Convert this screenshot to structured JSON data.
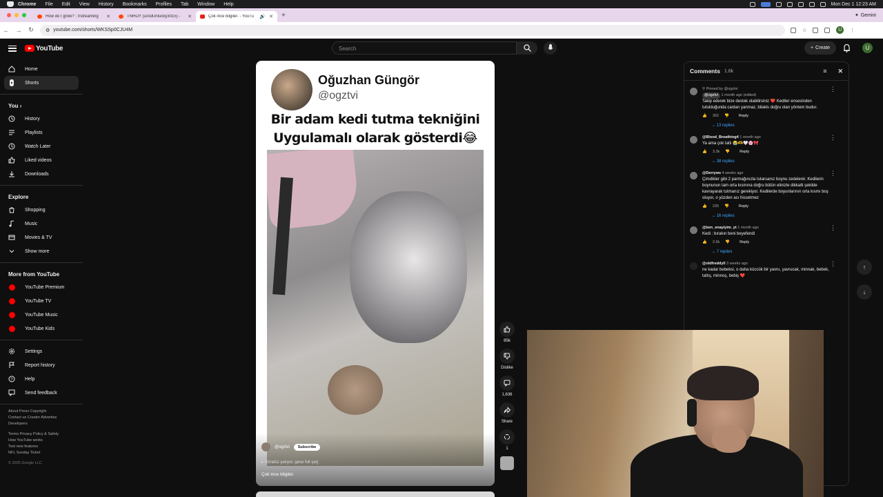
{
  "macos": {
    "app_name": "Chrome",
    "menus": [
      "File",
      "Edit",
      "View",
      "History",
      "Bookmarks",
      "Profiles",
      "Tab",
      "Window",
      "Help"
    ],
    "clock": "Mon Dec 1  12:23 AM"
  },
  "tabs": [
    {
      "title": "How do I grow? : r/streaming",
      "active": false
    },
    {
      "title": "TNROY (u/AdUnlucky3015) -",
      "active": false
    },
    {
      "title": "Çok ince bilgiler. - YouTu",
      "active": true
    }
  ],
  "browser": {
    "url": "youtube.com/shorts/WKSSp0CJU4M",
    "gemini_label": "Gemini",
    "profile_initial": "U"
  },
  "youtube": {
    "logo_text": "YouTube",
    "search_placeholder": "Search",
    "create_label": "Create",
    "avatar_initial": "U"
  },
  "sidebar": {
    "main": [
      {
        "label": "Home",
        "icon": "home-icon"
      },
      {
        "label": "Shorts",
        "icon": "shorts-icon",
        "active": true
      }
    ],
    "you_header": "You",
    "you_items": [
      {
        "label": "History",
        "icon": "history-icon"
      },
      {
        "label": "Playlists",
        "icon": "playlists-icon"
      },
      {
        "label": "Watch Later",
        "icon": "watch-later-icon"
      },
      {
        "label": "Liked videos",
        "icon": "liked-icon"
      },
      {
        "label": "Downloads",
        "icon": "download-icon"
      }
    ],
    "explore_header": "Explore",
    "explore_items": [
      {
        "label": "Shopping",
        "icon": "shopping-icon"
      },
      {
        "label": "Music",
        "icon": "music-icon"
      },
      {
        "label": "Movies & TV",
        "icon": "movies-icon"
      },
      {
        "label": "Show more",
        "icon": "chevron-down-icon"
      }
    ],
    "more_header": "More from YouTube",
    "more_items": [
      {
        "label": "YouTube Premium"
      },
      {
        "label": "YouTube TV"
      },
      {
        "label": "YouTube Music"
      },
      {
        "label": "YouTube Kids"
      }
    ],
    "settings_items": [
      {
        "label": "Settings",
        "icon": "gear-icon"
      },
      {
        "label": "Report history",
        "icon": "flag-icon"
      },
      {
        "label": "Help",
        "icon": "help-icon"
      },
      {
        "label": "Send feedback",
        "icon": "feedback-icon"
      }
    ],
    "footer_line1": "About  Press  Copyright",
    "footer_line2": "Contact us  Creator  Advertise",
    "footer_line3": "Developers",
    "footer_line4": "Terms  Privacy  Policy & Safety",
    "footer_line5": "How YouTube works",
    "footer_line6": "Test new features",
    "footer_line7": "NFL Sunday Ticket",
    "copyright": "© 2025 Google LLC"
  },
  "short": {
    "creator_name": "Oğuzhan Güngör",
    "creator_handle": "@ogztvi",
    "caption_line1": "Bir adam kedi tutma tekniğini",
    "caption_line2": "Uygulamalı olarak gösterdi😂",
    "channel": "@ogztvi",
    "subscribe_label": "Subscribe",
    "sound": "Gündüz yatıyor, gece full şarj",
    "title": "Çok ince bilgiler."
  },
  "actions": {
    "likes": "85k",
    "dislike_label": "Dislike",
    "comments": "1,636",
    "share_label": "Share",
    "remix_count": "1"
  },
  "comments_panel": {
    "title": "Comments",
    "count": "1.6k",
    "items": [
      {
        "pinned": "Pinned by @ogztvi",
        "author": "@ogztvi",
        "time": "1 month ago (edited)",
        "text": "Takip ederek bize destek olabilirsiniz ❤️ Kediler ensesinden tutulduğunda canları yanmaz, bilakis doğru olan yöntem budur.",
        "likes": "302",
        "replies": "13 replies"
      },
      {
        "author": "@Blood_Breathing4",
        "time": "1 month ago",
        "text": "Ya ama çok tatlı 😭🫶🤍🌸🎀",
        "likes": "3.3k",
        "replies": "38 replies"
      },
      {
        "author": "@Derrywx",
        "time": "4 weeks ago",
        "text": "Çimdikler gibi 2 parmağınızla tutarsanız boynu zedelenir. Kedilerin boynunun tam orta kısmına doğru bütün elinizle dikkatli şekilde kavrayarak tutmanız gerekiyor. Kedilerde boyunlarının orta kısmı boş oluyor, o yüzden acı hissetmez",
        "likes": "235",
        "replies": "16 replies"
      },
      {
        "author": "@ben_enayiyim_yt",
        "time": "1 month ago",
        "text": "Kedi : bırakın beni beyefendi",
        "likes": "2.6k",
        "replies": "7 replies"
      },
      {
        "author": "@oldfreddy0",
        "time": "3 weeks ago",
        "text": "ne kadar bebeksi, o daha küccük bir yavru, yavrucak, minnak, bebek, tatlış, minnoş, bebiş ❤️",
        "likes": "",
        "replies": ""
      }
    ],
    "reply_label": "Reply"
  },
  "colors": {
    "accent_red": "#ff0000",
    "link_blue": "#3ea6ff",
    "background": "#0f0f0f"
  }
}
